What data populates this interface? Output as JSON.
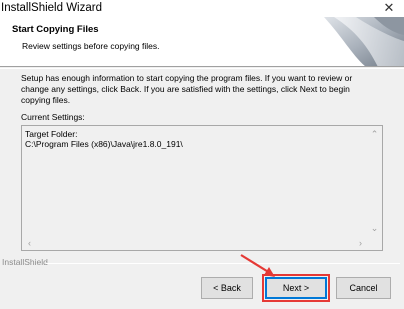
{
  "window": {
    "title": "InstallShield Wizard",
    "close_glyph": "✕"
  },
  "header": {
    "title": "Start Copying Files",
    "subtitle": "Review settings before copying files."
  },
  "body": {
    "description": "Setup has enough information to start copying the program files.  If you want to review or change any settings, click Back.  If you are satisfied with the settings, click Next to begin copying files.",
    "current_settings_label": "Current Settings:",
    "settings_text": "Target Folder:\nC:\\Program Files (x86)\\Java\\jre1.8.0_191\\"
  },
  "footer": {
    "group_label": "InstallShield",
    "back_label": "< Back",
    "next_label": "Next >",
    "cancel_label": "Cancel"
  },
  "colors": {
    "annotation": "#e53935",
    "focus": "#0078d7"
  },
  "icons": {
    "close": "close-icon",
    "scroll_up": "scroll-up-arrow-icon",
    "scroll_down": "scroll-down-arrow-icon",
    "scroll_left": "scroll-left-arrow-icon",
    "scroll_right": "scroll-right-arrow-icon"
  }
}
